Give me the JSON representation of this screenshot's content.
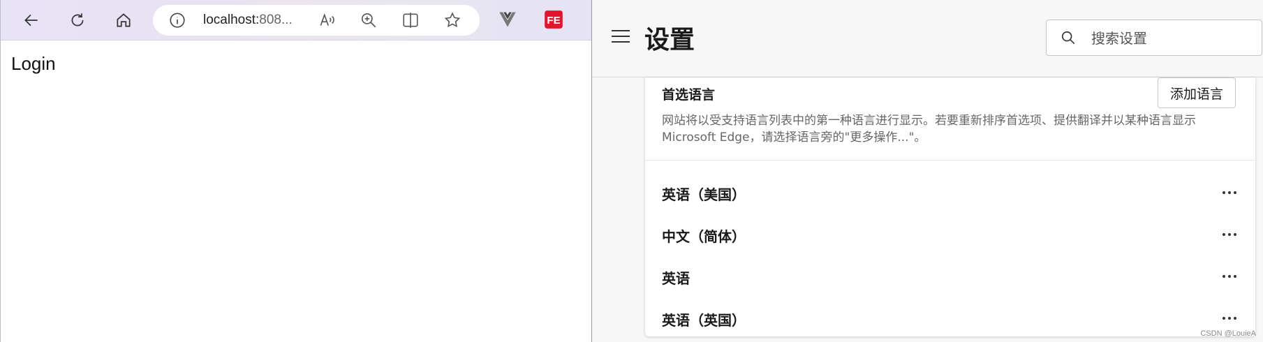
{
  "browser": {
    "url_visible": "localhost:",
    "url_tail": "808...",
    "page_heading": "Login"
  },
  "icons": [
    "back-icon",
    "refresh-icon",
    "home-icon",
    "info-icon",
    "read-aloud-icon",
    "zoom-in-icon",
    "split-screen-icon",
    "favorite-icon",
    "vue-devtools-icon",
    "fe-extension-icon",
    "hamburger-icon",
    "search-icon",
    "more-icon"
  ],
  "settings": {
    "title": "设置",
    "search_placeholder": "搜索设置",
    "preferred_languages": {
      "title": "首选语言",
      "add_button": "添加语言",
      "description": "网站将以受支持语言列表中的第一种语言进行显示。若要重新排序首选项、提供翻译并以某种语言显示 Microsoft Edge，请选择语言旁的\"更多操作...\"。",
      "languages": [
        {
          "label": "英语（美国）"
        },
        {
          "label": "中文（简体）"
        },
        {
          "label": "英语"
        },
        {
          "label": "英语（英国）"
        }
      ]
    }
  },
  "watermark": "CSDN @LouieA",
  "colors": {
    "toolbar_gradient_start": "#e8e3f6",
    "fe_badge": "#e5132b",
    "settings_bg": "#f7f7f7"
  }
}
